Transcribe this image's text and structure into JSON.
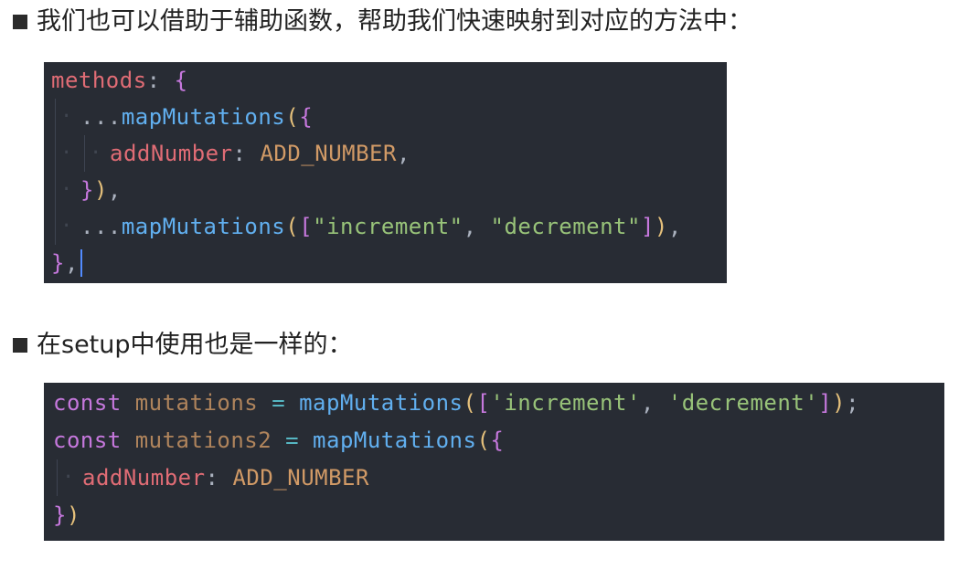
{
  "bullets": {
    "first": "我们也可以借助于辅助函数，帮助我们快速映射到对应的方法中：",
    "second": "在setup中使用也是一样的："
  },
  "code1": {
    "l1": {
      "prop": "methods",
      "colon": ": ",
      "brace": "{"
    },
    "l2": {
      "spread": "...",
      "func": "mapMutations",
      "paren": "(",
      "brace": "{"
    },
    "l3": {
      "prop": "addNumber",
      "colon": ": ",
      "const": "ADD_NUMBER",
      "comma": ","
    },
    "l4": {
      "brace": "}",
      "paren": ")",
      "comma": ","
    },
    "l5": {
      "spread": "...",
      "func": "mapMutations",
      "paren_open": "(",
      "bracket_open": "[",
      "s1": "\"increment\"",
      "sep": ", ",
      "s2": "\"decrement\"",
      "bracket_close": "]",
      "paren_close": ")",
      "comma": ","
    },
    "l6": {
      "brace": "}",
      "comma": ","
    }
  },
  "code2": {
    "l1": {
      "kw": "const",
      "var": " mutations ",
      "op": "=",
      "func": " mapMutations",
      "paren_open": "(",
      "bracket_open": "[",
      "s1": "'increment'",
      "sep": ", ",
      "s2": "'decrement'",
      "bracket_close": "]",
      "paren_close": ")",
      "semi": ";"
    },
    "l2": {
      "kw": "const",
      "var": " mutations2 ",
      "op": "=",
      "func": " mapMutations",
      "paren": "(",
      "brace": "{"
    },
    "l3": {
      "prop": "addNumber",
      "colon": ": ",
      "const": "ADD_NUMBER"
    },
    "l4": {
      "brace": "}",
      "paren": ")"
    }
  },
  "colors": {
    "background": "#ffffff",
    "code_bg": "#282c34",
    "property": "#e06c75",
    "function": "#61afef",
    "constant": "#d19a66",
    "string": "#98c379",
    "keyword": "#c678dd",
    "cursor": "#528bff"
  }
}
